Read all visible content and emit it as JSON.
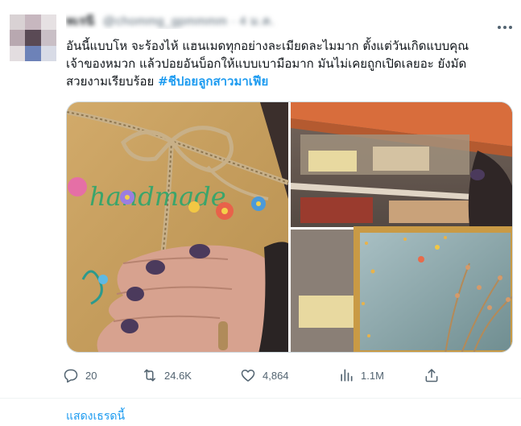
{
  "tweet": {
    "author_name": "ทเรนี",
    "author_handle": "@chommg_gpmmmm · 4 ม.ค.",
    "text_lines": [
      "อันนี้แบบโห จะร้องไห้ แฮนเมดทุกอย่างละเมียดละไมมาก ตั้งแต่วันเกิดแบบคุณ",
      "เจ้าของหมวก แล้วปอยอันบ็อกให้แบบเบามือมาก มันไม่เคยถูกเปิดเลยอะ ยังมัด"
    ],
    "text_last_line": "สวยงามเรียบร้อย ",
    "hashtag": "#ชีปอยลูกสาวมาเฟีย",
    "gift_lettering": "handmade"
  },
  "actions": {
    "replies": "20",
    "retweets": "24.6K",
    "likes": "4,864",
    "views": "1.1M"
  },
  "show_thread": "แสดงเธรดนี้",
  "icons": {
    "more": "more-horizontal-icon",
    "reply": "reply-icon",
    "retweet": "retweet-icon",
    "like": "heart-icon",
    "views": "views-chart-icon",
    "share": "share-icon"
  },
  "colors": {
    "text": "#0f1419",
    "secondary": "#536471",
    "link": "#1d9bf0",
    "border": "#cfd9de"
  }
}
